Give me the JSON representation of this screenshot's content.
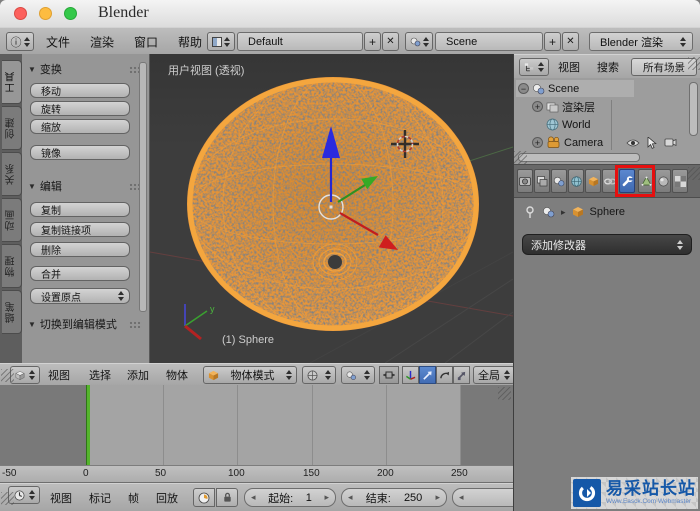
{
  "window": {
    "title": "Blender"
  },
  "icons": {
    "info": "ⓘ",
    "plus": "+",
    "close": "✕",
    "collapse": "▼",
    "expand_plus": "+",
    "collapse_minus": "−",
    "arrow_right": "▸",
    "stepper_left": "◂",
    "stepper_right": "▸"
  },
  "colors": {
    "accent_blue": "#4a79c5",
    "highlight_red": "#e60f0f",
    "playhead_green": "#55b42d",
    "sphere_orange": "#e8963a",
    "watermark_blue": "#1558a8"
  },
  "menubar": {
    "menus": [
      "文件",
      "渲染",
      "窗口",
      "帮助"
    ],
    "layout_value": "Default",
    "scene_value": "Scene",
    "engine_value": "Blender 渲染"
  },
  "toolshelf": {
    "tabs": [
      "工具",
      "创建",
      "关系",
      "动画",
      "物理",
      "蜡笔"
    ],
    "active_tab": "工具",
    "transform_title": "变换",
    "move": "移动",
    "rotate": "旋转",
    "scale": "缩放",
    "mirror": "镜像",
    "edit_title": "编辑",
    "duplicate": "复制",
    "duplicate_linked": "复制链接项",
    "delete": "删除",
    "join": "合并",
    "set_origin": "设置原点",
    "toggle_editmode_title": "切换到编辑模式"
  },
  "viewport": {
    "view_label": "用户视图 (透视)",
    "object_label": "(1) Sphere",
    "axis_y": "y",
    "header_menus": [
      "视图",
      "选择",
      "添加",
      "物体"
    ],
    "mode": "物体模式",
    "orientation": "全局"
  },
  "timeline": {
    "ticks": [
      "-50",
      "0",
      "50",
      "100",
      "150",
      "200",
      "250"
    ],
    "menus": [
      "视图",
      "标记",
      "帧",
      "回放"
    ],
    "start_label": "起始:",
    "start_value": "1",
    "end_label": "结束:",
    "end_value": "250"
  },
  "outliner": {
    "menus": [
      "视图",
      "搜索"
    ],
    "scenes_filter": "所有场景",
    "items": [
      {
        "label": "Scene"
      },
      {
        "label": "渲染层"
      },
      {
        "label": "World"
      },
      {
        "label": "Camera"
      }
    ]
  },
  "properties": {
    "tab_names": [
      "render",
      "render-layers",
      "scene",
      "world",
      "object",
      "constraints",
      "modifiers",
      "object-data",
      "material",
      "texture"
    ],
    "active_tab": "modifiers",
    "breadcrumb_object": "Sphere",
    "add_modifier": "添加修改器"
  },
  "watermark": {
    "title": "易采站长站",
    "subtitle": "Www.Easck.Com Webmaster"
  }
}
